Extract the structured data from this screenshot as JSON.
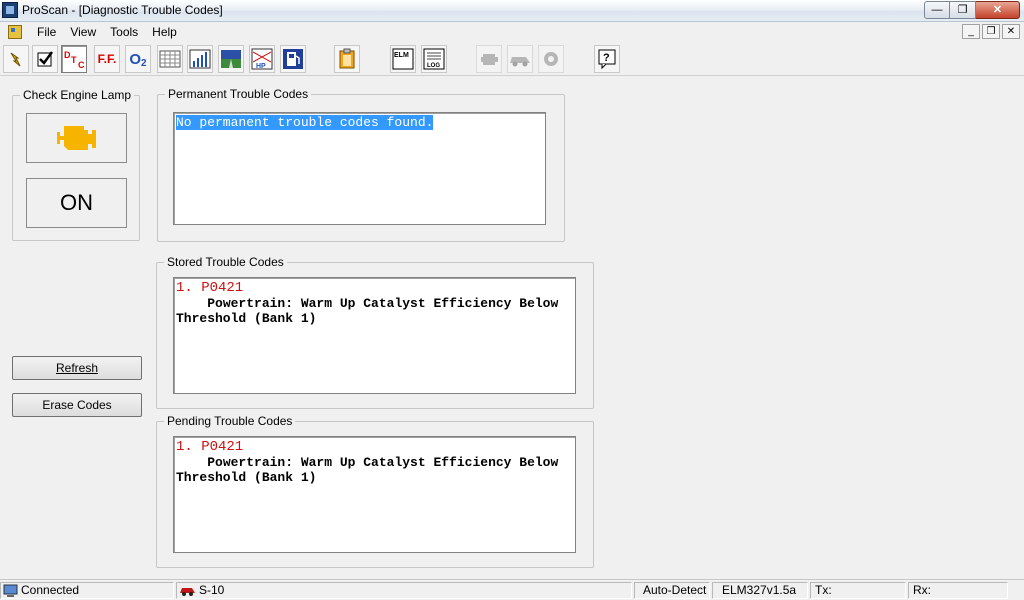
{
  "window": {
    "title": "ProScan - [Diagnostic Trouble Codes]",
    "min": "—",
    "max": "❐",
    "close": "✕"
  },
  "menu": {
    "items": [
      "File",
      "View",
      "Tools",
      "Help"
    ],
    "mdi_min": "_",
    "mdi_restore": "❐",
    "mdi_close": "✕"
  },
  "toolbar": {
    "ff_label": "F.F.",
    "o2_label": "O",
    "o2_sub": "2",
    "hp_label": "HP",
    "elm_label": "ELM",
    "log_label": "LOG"
  },
  "lamp": {
    "group_label": "Check Engine Lamp",
    "state": "ON",
    "color": "#f6b400"
  },
  "buttons": {
    "refresh": "Refresh",
    "erase": "Erase Codes"
  },
  "permanent": {
    "label": "Permanent Trouble Codes",
    "text": "No permanent trouble codes found."
  },
  "stored": {
    "label": "Stored Trouble Codes",
    "code": "1. P0421",
    "description": "    Powertrain: Warm Up Catalyst Efficiency Below\nThreshold (Bank 1)"
  },
  "pending": {
    "label": "Pending Trouble Codes",
    "code": "1. P0421",
    "description": "    Powertrain: Warm Up Catalyst Efficiency Below\nThreshold (Bank 1)"
  },
  "status": {
    "connection": "Connected",
    "vehicle": "S-10",
    "protocol": "Auto-Detect",
    "interface": "ELM327v1.5a",
    "tx": "Tx:",
    "rx": "Rx:"
  }
}
